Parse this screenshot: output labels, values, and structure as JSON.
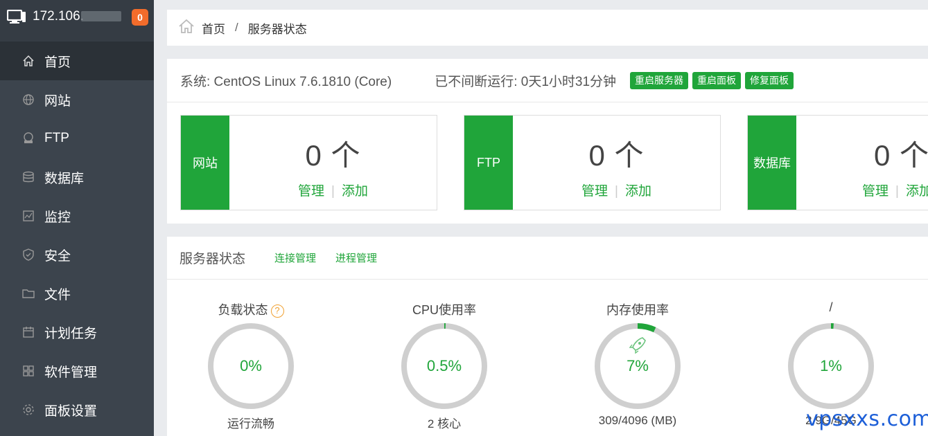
{
  "sidebar": {
    "server_ip": "172.106.",
    "notification_count": "0",
    "items": [
      {
        "label": "首页",
        "icon": "home-icon",
        "active": true
      },
      {
        "label": "网站",
        "icon": "globe-icon"
      },
      {
        "label": "FTP",
        "icon": "ftp-icon"
      },
      {
        "label": "数据库",
        "icon": "database-icon"
      },
      {
        "label": "监控",
        "icon": "monitor-chart-icon"
      },
      {
        "label": "安全",
        "icon": "shield-icon"
      },
      {
        "label": "文件",
        "icon": "folder-icon"
      },
      {
        "label": "计划任务",
        "icon": "calendar-icon"
      },
      {
        "label": "软件管理",
        "icon": "apps-grid-icon"
      },
      {
        "label": "面板设置",
        "icon": "gear-icon"
      }
    ]
  },
  "breadcrumb": {
    "home": "首页",
    "separator": "/",
    "current": "服务器状态"
  },
  "system": {
    "os": "系统: CentOS Linux 7.6.1810 (Core)",
    "uptime": "已不间断运行: 0天1小时31分钟",
    "buttons": [
      "重启服务器",
      "重启面板",
      "修复面板"
    ]
  },
  "cards": [
    {
      "label": "网站",
      "count": "0 个",
      "manage": "管理",
      "add": "添加"
    },
    {
      "label": "FTP",
      "count": "0 个",
      "manage": "管理",
      "add": "添加"
    },
    {
      "label": "数据库",
      "count": "0 个",
      "manage": "管理",
      "add": "添加"
    }
  ],
  "status": {
    "title": "服务器状态",
    "links": [
      "连接管理",
      "进程管理"
    ],
    "gauges": [
      {
        "title": "负载状态",
        "help": "?",
        "value": "0%",
        "fraction": 0.0,
        "sub": "运行流畅"
      },
      {
        "title": "CPU使用率",
        "value": "0.5%",
        "fraction": 0.005,
        "sub": "2 核心"
      },
      {
        "title": "内存使用率",
        "value": "7%",
        "fraction": 0.07,
        "sub": "309/4096 (MB)",
        "icon": "rocket-icon"
      },
      {
        "title": "/",
        "value": "1%",
        "fraction": 0.01,
        "sub": "2.9G/45G"
      }
    ]
  },
  "watermark": "vpsxxs.com",
  "colors": {
    "accent": "#20a53a",
    "sidebar": "#3c444d",
    "badge": "#f26c2b"
  }
}
